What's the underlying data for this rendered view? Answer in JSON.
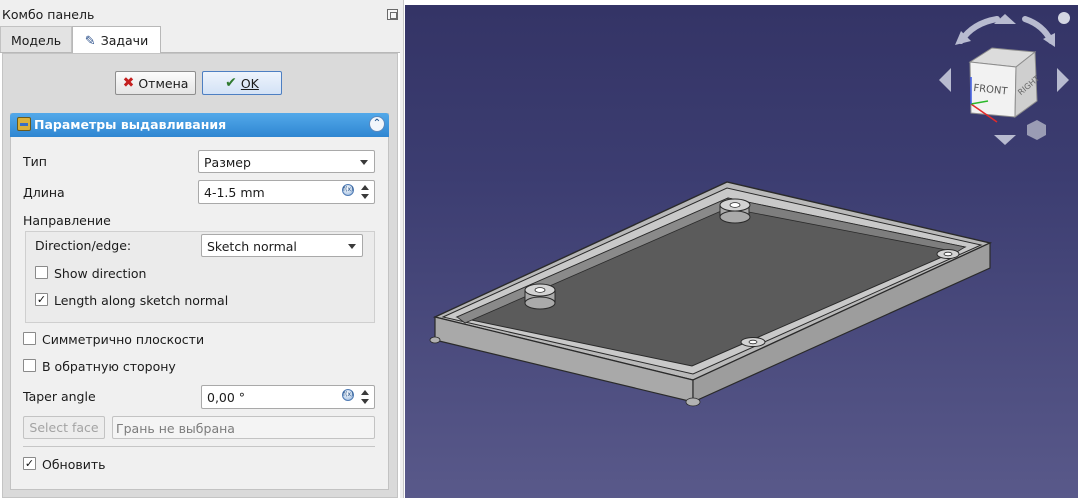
{
  "panel": {
    "title": "Комбо панель"
  },
  "tabs": {
    "model": "Модель",
    "tasks": "Задачи"
  },
  "buttons": {
    "cancel": "Отмена",
    "ok": "OK"
  },
  "group": {
    "title": "Параметры выдавливания",
    "type_label": "Тип",
    "type_value": "Размер",
    "length_label": "Длина",
    "length_value": "4-1.5 mm",
    "direction_label": "Направление",
    "direction_edge_label": "Direction/edge:",
    "direction_edge_value": "Sketch normal",
    "show_direction": {
      "label": "Show direction",
      "checked": false
    },
    "length_along_normal": {
      "label": "Length along sketch normal",
      "checked": true
    },
    "symmetric": {
      "label": "Симметрично плоскости",
      "checked": false
    },
    "reversed": {
      "label": "В обратную сторону",
      "checked": false
    },
    "taper_label": "Taper angle",
    "taper_value": "0,00 °",
    "select_face_button": "Select face",
    "face_placeholder": "Грань не выбрана",
    "refresh": {
      "label": "Обновить",
      "checked": true
    }
  },
  "navcube": {
    "front": "FRONT",
    "right": "RIGHT"
  },
  "colors": {
    "viewport_top": "#343466",
    "viewport_bottom": "#59598a",
    "group_header": "#3a90d8",
    "model_face": "#5b5b5b",
    "model_wall": "#bcbcbc"
  }
}
